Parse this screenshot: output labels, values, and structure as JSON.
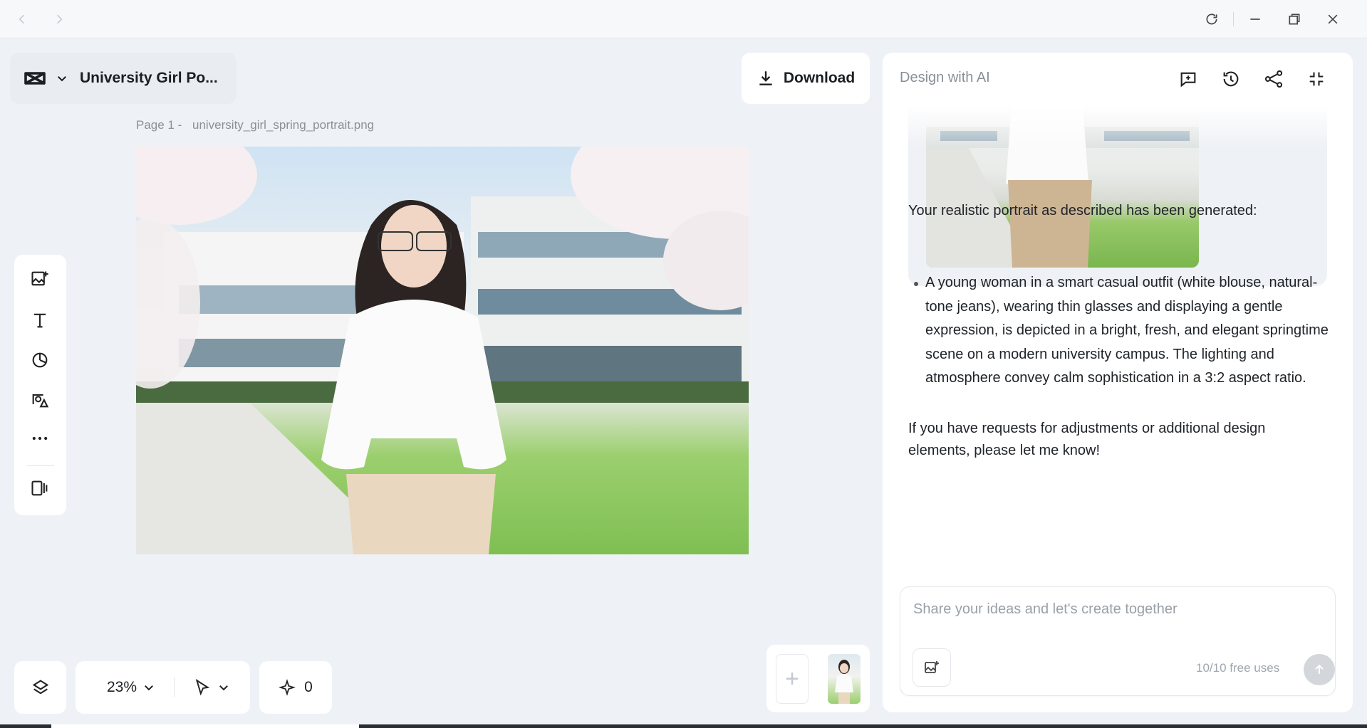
{
  "doc": {
    "title": "University Girl Po...",
    "download_label": "Download"
  },
  "canvas": {
    "page_prefix": "Page 1 -",
    "file_name": "university_girl_spring_portrait.png"
  },
  "left_toolbar": {
    "tools": [
      "add-image",
      "text",
      "shapes",
      "elements",
      "more",
      "pages-panel"
    ]
  },
  "bottom_bar": {
    "zoom": "23%",
    "credits": "0"
  },
  "ai_panel": {
    "title": "Design with AI",
    "intro": "Your realistic portrait as described has been generated:",
    "bullet": "A young woman in a smart casual outfit (white blouse, natural-tone jeans), wearing thin glasses and displaying a gentle expression, is depicted in a bright, fresh, and elegant springtime scene on a modern university campus. The lighting and atmosphere convey calm sophistication in a 3:2 aspect ratio.",
    "closing": "If you have requests for adjustments or additional design elements, please let me know!",
    "input_placeholder": "Share your ideas and let's create together",
    "free_uses": "10/10 free uses"
  },
  "colors": {
    "background": "#eef2f6",
    "panel": "#ffffff",
    "muted_text": "#8a9098"
  }
}
